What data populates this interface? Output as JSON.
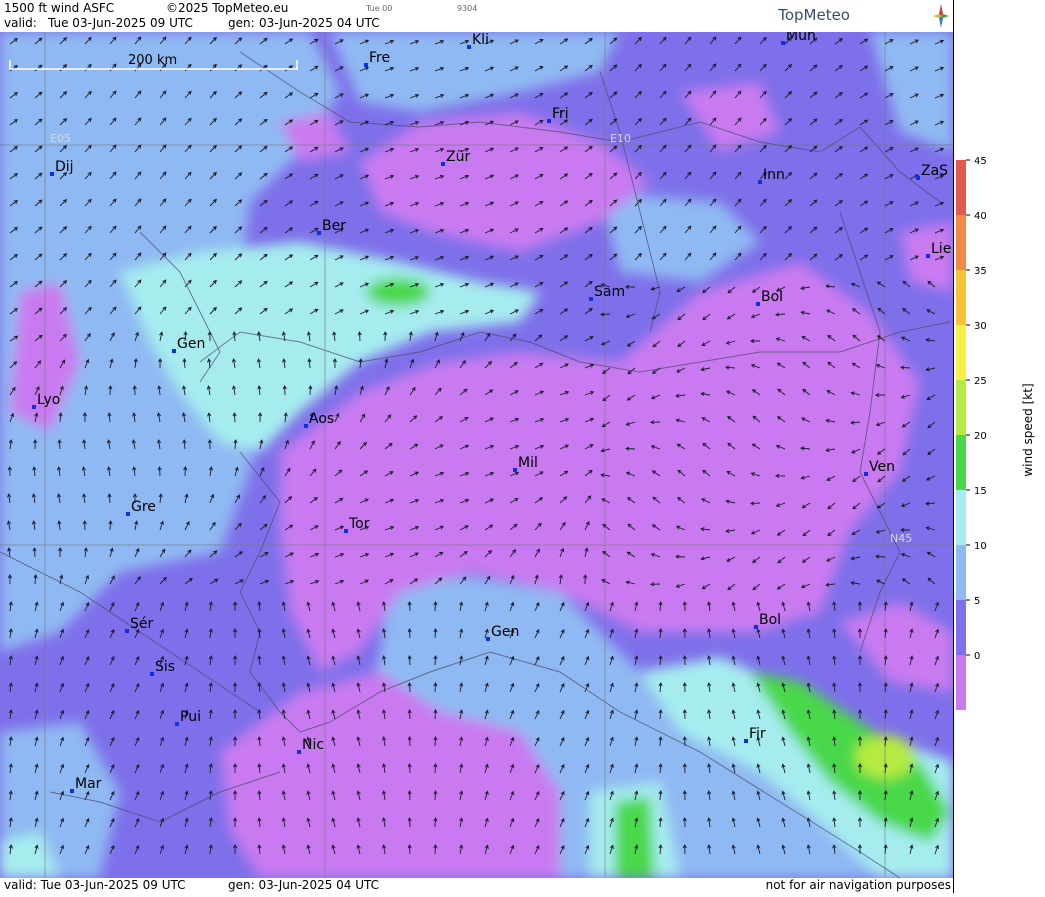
{
  "header": {
    "product": "1500 ft wind ASFC",
    "copyright": "©2025 TopMeteo.eu",
    "valid_label": "valid:",
    "valid_time": "Tue  03-Jun-2025  09 UTC",
    "gen_label": "gen:",
    "gen_time": "03-Jun-2025 04 UTC",
    "small_text_1": "Tue 00",
    "small_text_2": "9304",
    "logo_text": "TopMeteo"
  },
  "footer": {
    "valid_text": "valid:  Tue  03-Jun-2025  09 UTC",
    "gen_text": "gen: 03-Jun-2025 04 UTC",
    "disclaimer": "not for air navigation purposes"
  },
  "map": {
    "scale_label": "200 km",
    "grid_labels": [
      "E05",
      "E10",
      "N45"
    ],
    "cities": [
      {
        "name": "Kli"
      },
      {
        "name": "Mün"
      },
      {
        "name": "Fre"
      },
      {
        "name": "Fri"
      },
      {
        "name": "Dij"
      },
      {
        "name": "Zür"
      },
      {
        "name": "Inn"
      },
      {
        "name": "ZaS"
      },
      {
        "name": "Ber"
      },
      {
        "name": "Lie"
      },
      {
        "name": "Sam"
      },
      {
        "name": "Bol"
      },
      {
        "name": "Gen"
      },
      {
        "name": "Lyo"
      },
      {
        "name": "Aos"
      },
      {
        "name": "Mil"
      },
      {
        "name": "Ven"
      },
      {
        "name": "Gre"
      },
      {
        "name": "Tor"
      },
      {
        "name": "Sér"
      },
      {
        "name": "Gen"
      },
      {
        "name": "Bol"
      },
      {
        "name": "Sis"
      },
      {
        "name": "Pui"
      },
      {
        "name": "Fir"
      },
      {
        "name": "Nic"
      },
      {
        "name": "Mar"
      }
    ]
  },
  "legend": {
    "title": "wind speed [kt]",
    "ticks": [
      "45",
      "40",
      "35",
      "30",
      "25",
      "20",
      "15",
      "10",
      "5",
      "0"
    ],
    "colors": [
      "#e05a4f",
      "#ef8a48",
      "#f5c23a",
      "#f5ef4a",
      "#b6ea42",
      "#48d84a",
      "#a6ecef",
      "#8fb9f2",
      "#7e70ea",
      "#c97af0"
    ]
  }
}
